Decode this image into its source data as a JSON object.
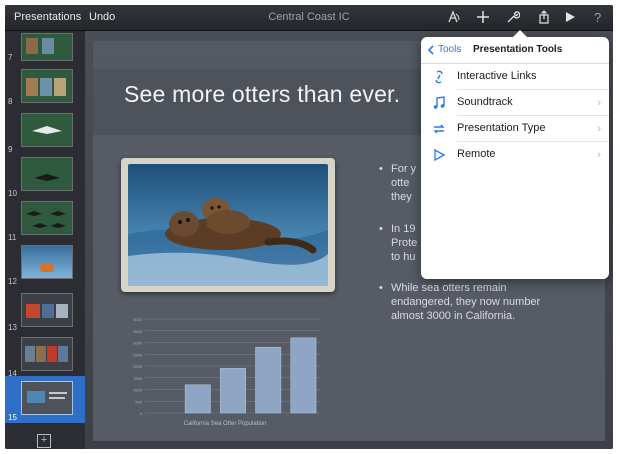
{
  "topbar": {
    "presentations_label": "Presentations",
    "undo_label": "Undo",
    "doc_title": "Central Coast IC",
    "icons": [
      "animate-icon",
      "add-icon",
      "wrench-icon",
      "share-icon",
      "play-icon",
      "help-icon"
    ]
  },
  "sidebar": {
    "slides": [
      {
        "number": "7"
      },
      {
        "number": "8"
      },
      {
        "number": "9"
      },
      {
        "number": "10"
      },
      {
        "number": "11"
      },
      {
        "number": "12"
      },
      {
        "number": "13"
      },
      {
        "number": "14"
      },
      {
        "number": "15",
        "selected": true
      }
    ],
    "selected_color": "#2f6fc8"
  },
  "slide": {
    "title": "See more otters than ever.",
    "bullets": [
      {
        "text_lines": [
          "For y",
          "otte",
          "they"
        ]
      },
      {
        "text_lines": [
          "In 19",
          "Prote",
          "to hu"
        ]
      },
      {
        "text_lines": [
          "While sea otters remain",
          "endangered, they now number",
          "almost 3000 in California."
        ]
      }
    ],
    "bullet_char": "•"
  },
  "chart_data": {
    "type": "bar",
    "title": "",
    "xlabel": "California Sea Otter Population",
    "ylabel": "",
    "categories": [
      "",
      "",
      "",
      "",
      ""
    ],
    "values": [
      0,
      1200,
      1900,
      2800,
      3200
    ],
    "ylim": [
      0,
      4000
    ],
    "yticks": [
      0,
      500,
      1000,
      1500,
      2000,
      2500,
      3000,
      3500,
      4000
    ],
    "grid": true
  },
  "popover": {
    "back_label": "Tools",
    "title": "Presentation Tools",
    "items": [
      {
        "label": "Interactive Links",
        "icon": "link-icon",
        "has_chevron": false
      },
      {
        "label": "Soundtrack",
        "icon": "music-note-icon",
        "has_chevron": true
      },
      {
        "label": "Presentation Type",
        "icon": "loop-arrows-icon",
        "has_chevron": true
      },
      {
        "label": "Remote",
        "icon": "play-outline-icon",
        "has_chevron": true
      }
    ],
    "accent_color": "#2a7be4"
  }
}
